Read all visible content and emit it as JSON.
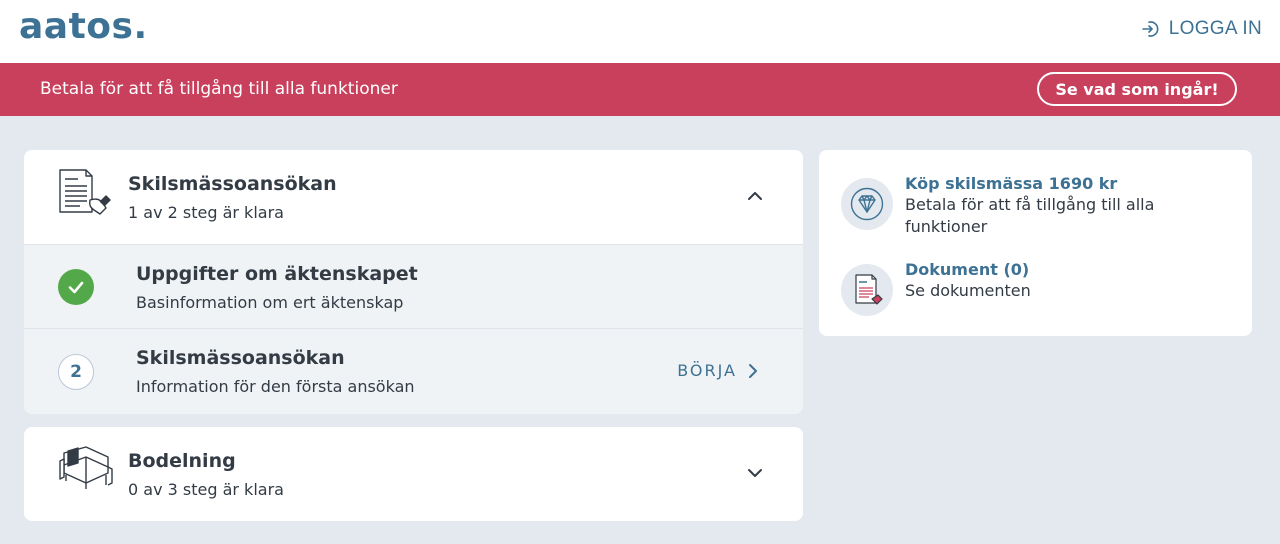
{
  "header": {
    "logo": "aatos.",
    "login_label": "LOGGA IN"
  },
  "banner": {
    "text": "Betala för att få tillgång till alla funktioner",
    "button_label": "Se vad som ingår!"
  },
  "sections": [
    {
      "title": "Skilsmässoansökan",
      "progress": "1 av 2 steg är klara",
      "expanded": true,
      "steps": [
        {
          "title": "Uppgifter om äktenskapet",
          "subtitle": "Basinformation om ert äktenskap",
          "done": true
        },
        {
          "number": "2",
          "title": "Skilsmässoansökan",
          "subtitle": "Information för den första ansökan",
          "action_label": "BÖRJA",
          "done": false
        }
      ]
    },
    {
      "title": "Bodelning",
      "progress": "0 av 3 steg är klara",
      "expanded": false
    }
  ],
  "sidebar": {
    "items": [
      {
        "title": "Köp skilsmässa 1690 kr",
        "subtitle": "Betala för att få tillgång till alla funktioner",
        "icon": "diamond-icon"
      },
      {
        "title": "Dokument (0)",
        "subtitle": "Se dokumenten",
        "icon": "document-icon"
      }
    ]
  },
  "colors": {
    "brand": "#3d7294",
    "banner": "#c9405d",
    "success": "#53a84a",
    "background": "#e4e9ef"
  }
}
